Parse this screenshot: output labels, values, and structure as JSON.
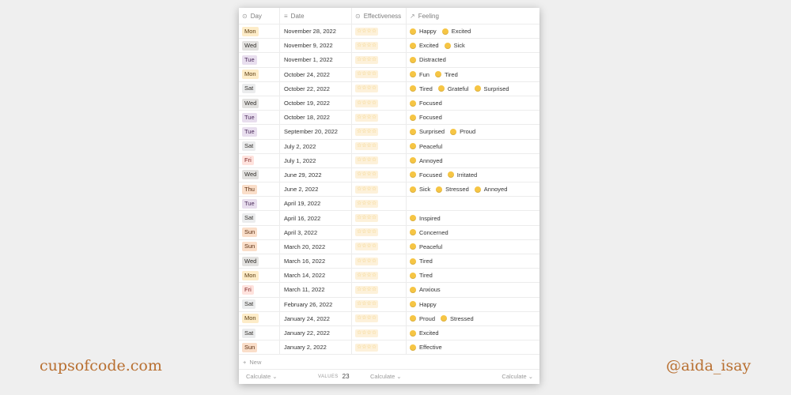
{
  "colors": {
    "Mon": {
      "bg": "#fdecc8",
      "fg": "#5a3b10"
    },
    "Tue": {
      "bg": "#e8deee",
      "fg": "#4a2a5a"
    },
    "Wed": {
      "bg": "#e3e2e0",
      "fg": "#32302c"
    },
    "Thu": {
      "bg": "#fadec9",
      "fg": "#5a2d10"
    },
    "Fri": {
      "bg": "#ffe2dd",
      "fg": "#7a1f1f"
    },
    "Sat": {
      "bg": "#ebeced",
      "fg": "#32302c"
    },
    "Sun": {
      "bg": "#fadec9",
      "fg": "#5a2d10"
    },
    "brand": "#b86f30",
    "star": "#f0c96b"
  },
  "table": {
    "headers": {
      "day": "Day",
      "date": "Date",
      "effectiveness": "Effectiveness",
      "feeling": "Feeling"
    },
    "stars_text": "☆☆☆☆",
    "rows": [
      {
        "day": "Mon",
        "date": "November 28, 2022",
        "feelings": [
          "Happy",
          "Excited"
        ]
      },
      {
        "day": "Wed",
        "date": "November 9, 2022",
        "feelings": [
          "Excited",
          "Sick"
        ]
      },
      {
        "day": "Tue",
        "date": "November 1, 2022",
        "feelings": [
          "Distracted"
        ]
      },
      {
        "day": "Mon",
        "date": "October 24, 2022",
        "feelings": [
          "Fun",
          "Tired"
        ]
      },
      {
        "day": "Sat",
        "date": "October 22, 2022",
        "feelings": [
          "Tired",
          "Grateful",
          "Surprised"
        ]
      },
      {
        "day": "Wed",
        "date": "October 19, 2022",
        "feelings": [
          "Focused"
        ]
      },
      {
        "day": "Tue",
        "date": "October 18, 2022",
        "feelings": [
          "Focused"
        ]
      },
      {
        "day": "Tue",
        "date": "September 20, 2022",
        "feelings": [
          "Surprised",
          "Proud"
        ]
      },
      {
        "day": "Sat",
        "date": "July 2, 2022",
        "feelings": [
          "Peaceful"
        ]
      },
      {
        "day": "Fri",
        "date": "July 1, 2022",
        "feelings": [
          "Annoyed"
        ]
      },
      {
        "day": "Wed",
        "date": "June 29, 2022",
        "feelings": [
          "Focused",
          "Irritated"
        ]
      },
      {
        "day": "Thu",
        "date": "June 2, 2022",
        "feelings": [
          "Sick",
          "Stressed",
          "Annoyed"
        ]
      },
      {
        "day": "Tue",
        "date": "April 19, 2022",
        "feelings": []
      },
      {
        "day": "Sat",
        "date": "April 16, 2022",
        "feelings": [
          "Inspired"
        ]
      },
      {
        "day": "Sun",
        "date": "April 3, 2022",
        "feelings": [
          "Concerned"
        ]
      },
      {
        "day": "Sun",
        "date": "March 20, 2022",
        "feelings": [
          "Peaceful"
        ]
      },
      {
        "day": "Wed",
        "date": "March 16, 2022",
        "feelings": [
          "Tired"
        ]
      },
      {
        "day": "Mon",
        "date": "March 14, 2022",
        "feelings": [
          "Tired"
        ]
      },
      {
        "day": "Fri",
        "date": "March 11, 2022",
        "feelings": [
          "Anxious"
        ]
      },
      {
        "day": "Sat",
        "date": "February 26, 2022",
        "feelings": [
          "Happy"
        ]
      },
      {
        "day": "Mon",
        "date": "January 24, 2022",
        "feelings": [
          "Proud",
          "Stressed"
        ]
      },
      {
        "day": "Sat",
        "date": "January 22, 2022",
        "feelings": [
          "Excited"
        ]
      },
      {
        "day": "Sun",
        "date": "January 2, 2022",
        "feelings": [
          "Effective"
        ]
      }
    ],
    "new_label": "New",
    "footer": {
      "calculate_label": "Calculate",
      "values_label": "VALUES",
      "values_count": "23"
    }
  },
  "branding": {
    "left": "cupsofcode.com",
    "right": "@aida_isay"
  }
}
